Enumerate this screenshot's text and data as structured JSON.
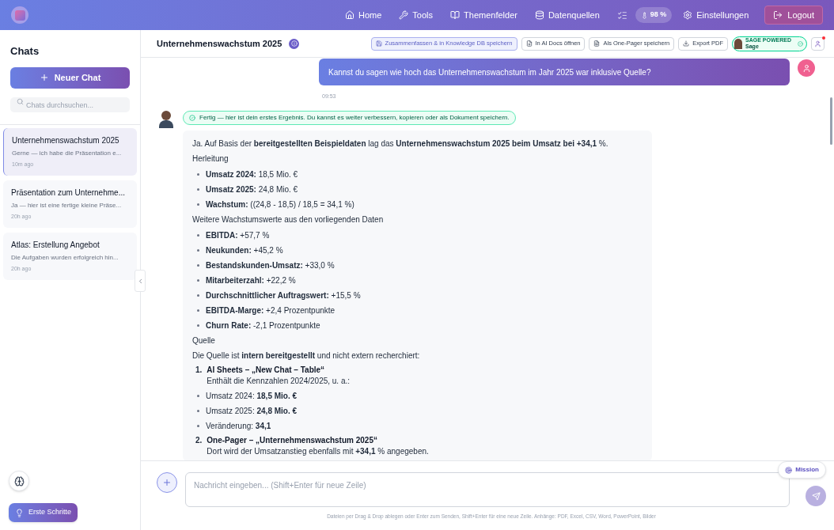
{
  "topbar": {
    "nav": [
      {
        "kind": "home",
        "label": "Home"
      },
      {
        "kind": "tools",
        "label": "Tools"
      },
      {
        "kind": "topics",
        "label": "Themenfelder"
      },
      {
        "kind": "sources",
        "label": "Datenquellen"
      }
    ],
    "battery": "98 %",
    "settings": "Einstellungen",
    "logout": "Logout"
  },
  "sidebar": {
    "title": "Chats",
    "new_chat": "Neuer Chat",
    "search": {
      "placeholder": "Chats durchsuchen..."
    },
    "chats": [
      {
        "title": "Unternehmenswachstum 2025",
        "preview": "Gerne — ich habe die Präsentation e...",
        "time": "10m ago",
        "selected": true
      },
      {
        "title": "Präsentation zum Unternehme...",
        "preview": "Ja — hier ist eine fertige kleine Präse...",
        "time": "20h ago",
        "selected": false
      },
      {
        "title": "Atlas: Erstellung Angebot",
        "preview": "Die Aufgaben wurden erfolgreich hin...",
        "time": "20h ago",
        "selected": false
      }
    ],
    "onboarding": "Erste Schritte"
  },
  "chat": {
    "title": "Unternehmenswachstum 2025",
    "actions": [
      {
        "kind": "save",
        "label": "Zusammenfassen & in Knowledge DB speichern"
      },
      {
        "kind": "docs",
        "label": "In AI Docs öffnen"
      },
      {
        "kind": "onepager",
        "label": "Als One-Pager speichern"
      },
      {
        "kind": "pdf",
        "label": "Export PDF"
      }
    ],
    "sage": {
      "kicker": "SAGE POWERED",
      "name": "Sage"
    },
    "user_message": {
      "text": "Kannst du sagen wie hoch das Unternehmenswachstum im Jahr 2025 war inklusive Quelle?",
      "time": "09:53"
    },
    "status": "Fertig — hier ist dein erstes Ergebnis. Du kannst es weiter verbessern, kopieren oder als Dokument speichern.",
    "answer": [
      {
        "kind": "paragraph",
        "text": "Ja. Auf Basis der **bereitgestellten Beispieldaten** lag das **Unternehmenswachstum 2025 beim Umsatz bei +34,1** %."
      },
      {
        "kind": "paragraph",
        "text": "Herleitung"
      },
      {
        "kind": "bullets",
        "items": [
          "**Umsatz 2024:** 18,5 Mio. €",
          "**Umsatz 2025:** 24,8 Mio. €",
          "**Wachstum:** ((24,8 - 18,5) / 18,5 = 34,1 %)"
        ]
      },
      {
        "kind": "paragraph",
        "text": "Weitere Wachstumswerte aus den vorliegenden Daten"
      },
      {
        "kind": "bullets",
        "items": [
          "**EBITDA:** +57,7 %",
          "**Neukunden:** +45,2 %",
          "**Bestandskunden-Umsatz:** +33,0 %",
          "**Mitarbeiterzahl:** +22,2 %",
          "**Durchschnittlicher Auftragswert:** +15,5 %",
          "**EBITDA-Marge:** +2,4 Prozentpunkte",
          "**Churn Rate:** -2,1 Prozentpunkte"
        ]
      },
      {
        "kind": "paragraph",
        "text": "Quelle"
      },
      {
        "kind": "paragraph",
        "text": "Die Quelle ist **intern bereitgestellt** und nicht extern recherchiert:"
      },
      {
        "kind": "numbered",
        "number": "1.",
        "title": "AI Sheets – „New Chat – Table“",
        "note": "Enthält die Kennzahlen 2024/2025, u. a.:"
      },
      {
        "kind": "bullets",
        "items": [
          "Umsatz 2024: **18,5 Mio. €**",
          "Umsatz 2025: **24,8 Mio. €**",
          "Veränderung: **34,1**"
        ]
      },
      {
        "kind": "numbered",
        "number": "2.",
        "title": "One-Pager – „Unternehmenswachstum 2025“",
        "note": "Dort wird der Umsatzanstieg ebenfalls mit **+34,1** % angegeben."
      }
    ]
  },
  "composer": {
    "placeholder": "Nachricht eingeben... (Shift+Enter für neue Zeile)",
    "mission": "Mission",
    "hint": "Dateien per Drag & Drop ablegen oder Enter zum Senden, Shift+Enter für eine neue Zeile. Anhänge: PDF, Excel, CSV, Word, PowerPoint, Bilder"
  }
}
